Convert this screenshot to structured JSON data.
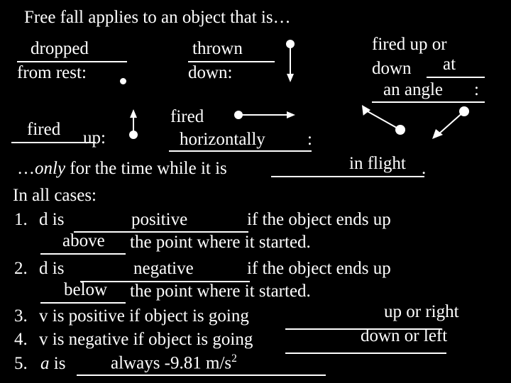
{
  "slide": {
    "background_color": "#000000",
    "text_color": "#ffffff",
    "title": "Free fall applies to an object that is…"
  },
  "cases": {
    "dropped": {
      "answer": "dropped",
      "prompt": "from rest:"
    },
    "thrown": {
      "answer": "thrown",
      "prompt": "down:"
    },
    "fired_angle": {
      "prompt_line1": "fired up or",
      "prompt_line2": "down",
      "answer_line1": "at",
      "answer_line2": "an angle",
      "colon": ":"
    },
    "fired_up": {
      "answer": "fired",
      "prompt": "up:"
    },
    "fired_horizontal": {
      "answer_line1": "fired",
      "answer_line2": "horizontally",
      "colon": ":"
    }
  },
  "only_line": {
    "prefix": "…",
    "emphasis": "only",
    "middle": " for the time while it is ",
    "answer": "in flight",
    "suffix": "."
  },
  "in_all_cases_label": "In all cases:",
  "rules": [
    {
      "number": "1.",
      "lead": "d is",
      "answer1": "positive",
      "mid": "if the object ends up",
      "answer2": "above",
      "tail": "the point where it started."
    },
    {
      "number": "2.",
      "lead": "d is",
      "answer1": "negative",
      "mid": "if the object ends up",
      "answer2": "below",
      "tail": "the point where it started."
    },
    {
      "number": "3.",
      "lead": "v is positive if object is going",
      "answer1": "up or right",
      "mid": "",
      "answer2": "",
      "tail": ""
    },
    {
      "number": "4.",
      "lead": "v is negative if object is going",
      "answer1": "down or left",
      "mid": "",
      "answer2": "",
      "tail": ""
    },
    {
      "number": "5.",
      "lead_italic": "a",
      "lead": " is",
      "answer1": "always -9.81 m/s",
      "answer1_sup": "2",
      "mid": "",
      "answer2": "",
      "tail": ""
    }
  ],
  "diagrams": [
    {
      "name": "down-arrow",
      "direction": "down",
      "dot": "start"
    },
    {
      "name": "up-arrow",
      "direction": "up",
      "dot": "start"
    },
    {
      "name": "horizontal-arrow",
      "direction": "right",
      "dot": "start"
    },
    {
      "name": "angle-arrow-up-left",
      "direction": "up-left",
      "dot": "start"
    },
    {
      "name": "angle-arrow-down-left",
      "direction": "down-left",
      "dot": "start"
    },
    {
      "name": "rest-dot",
      "direction": "none",
      "dot": "only"
    }
  ]
}
